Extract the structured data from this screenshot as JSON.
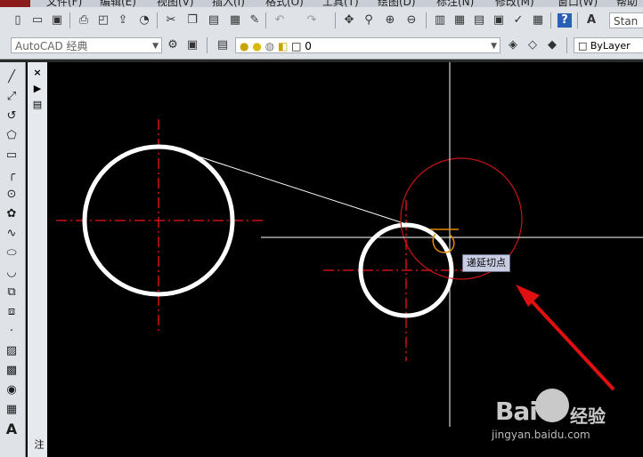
{
  "menubar": {
    "items": [
      "文件(F)",
      "编辑(E)",
      "视图(V)",
      "插入(I)",
      "格式(O)",
      "工具(T)",
      "绘图(D)",
      "标注(N)",
      "修改(M)",
      "窗口(W)",
      "帮助"
    ]
  },
  "toolbar": {
    "icons": [
      "new-icon",
      "open-icon",
      "save-icon",
      "print-icon",
      "preview-icon",
      "publish-icon",
      "3d-icon",
      "cut-icon",
      "copy-icon",
      "paste-icon",
      "match-icon",
      "brush-icon",
      "undo-icon",
      "redo-icon",
      "pan-icon",
      "zoom-icon",
      "zoom-window-icon",
      "zoom-prev-icon",
      "properties-icon",
      "design-center-icon",
      "tool-palette-icon",
      "sheet-icon",
      "markup-icon",
      "calc-icon",
      "help-icon"
    ],
    "text_style_value": "Stan"
  },
  "toolbar2": {
    "workspace_value": "AutoCAD 经典",
    "layer_value": "0",
    "color_value": "ByLayer"
  },
  "left_toolbar": {
    "icons": [
      "line-icon",
      "construction-line-icon",
      "polyline-icon",
      "polygon-icon",
      "rectangle-icon",
      "arc-icon",
      "circle-icon",
      "revcloud-icon",
      "spline-icon",
      "ellipse-icon",
      "ellipse-arc-icon",
      "insert-block-icon",
      "make-block-icon",
      "point-icon",
      "hatch-icon",
      "gradient-icon",
      "region-icon",
      "table-icon",
      "text-icon"
    ]
  },
  "palette": {
    "close_label": "×",
    "label": "批注"
  },
  "tooltip": {
    "text": "递延切点"
  },
  "watermark": {
    "logo": "Bai",
    "cn": "经验",
    "sub": "jingyan.baidu.com"
  },
  "colors": {
    "background": "#000000",
    "center_line": "#d01010",
    "entity": "#ffffff",
    "preview": "#d01818",
    "marker": "#e98b00",
    "arrow": "#e01010"
  }
}
